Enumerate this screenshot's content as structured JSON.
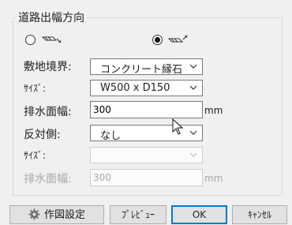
{
  "group": {
    "title": "道路出幅方向",
    "options": [
      {
        "icon": "road-extend-right-down-icon",
        "checked": false
      },
      {
        "icon": "road-extend-right-up-icon",
        "checked": true
      }
    ]
  },
  "fields": {
    "boundary_label": "敷地境界:",
    "boundary_value": "コンクリート縁石",
    "size_label": "ｻｲｽﾞ:",
    "size_value": "W500 x D150",
    "drain_label": "排水面幅:",
    "drain_value": "300",
    "drain_unit": "mm",
    "opposite_label": "反対側:",
    "opposite_value": "なし",
    "opp_size_label": "ｻｲｽﾞ:",
    "opp_size_value": "",
    "opp_drain_label": "排水面幅:",
    "opp_drain_value": "300",
    "opp_drain_unit": "mm"
  },
  "buttons": {
    "settings": "作図設定",
    "preview": "ﾌﾟﾚﾋﾞｭｰ",
    "ok": "OK",
    "cancel": "ｷｬﾝｾﾙ"
  },
  "colors": {
    "accent": "#0078d7",
    "disabled_text": "#a8a8a8"
  }
}
